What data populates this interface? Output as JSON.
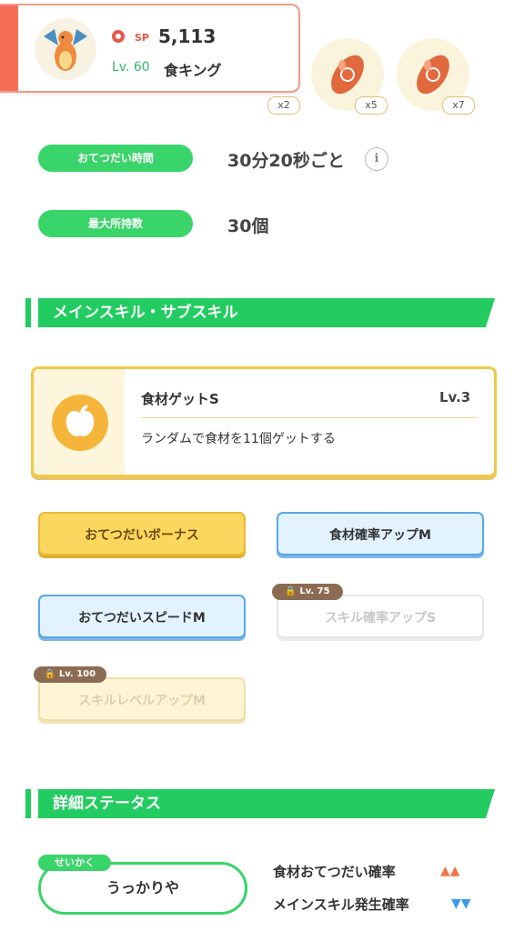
{
  "header": {
    "sp_label": "SP",
    "sp_value": "5,113",
    "level": "Lv. 60",
    "name": "食キング"
  },
  "ingredients": [
    {
      "count": "x2"
    },
    {
      "count": "x5"
    },
    {
      "count": "x7"
    }
  ],
  "stats": {
    "help_time_label": "おてつだい時間",
    "help_time_value": "30分20秒ごと",
    "info_icon": "i",
    "max_carry_label": "最大所持数",
    "max_carry_value": "30個"
  },
  "skills_section": {
    "title": "メインスキル・サブスキル",
    "main_skill": {
      "name": "食材ゲットS",
      "level": "Lv.3",
      "description": "ランダムで食材を11個ゲットする"
    },
    "sub_skills": [
      {
        "label": "おてつだいボーナス",
        "style": "gold"
      },
      {
        "label": "食材確率アップM",
        "style": "blue"
      },
      {
        "label": "おてつだいスピードM",
        "style": "blue"
      },
      {
        "label": "スキル確率アップS",
        "style": "locked",
        "lock": "Lv. 75"
      },
      {
        "label": "スキルレベルアップM",
        "style": "locked-gold",
        "lock": "Lv. 100"
      }
    ]
  },
  "details_section": {
    "title": "詳細ステータス",
    "nature_tag": "せいかく",
    "nature": "うっかりや",
    "up_effect": "食材おてつだい確率",
    "up_marks": "▲▲",
    "down_effect": "メインスキル発生確率",
    "down_marks": "▼▼"
  },
  "colors": {
    "accent_green": "#22cc60",
    "pill_green": "#39d46a",
    "header_red": "#f56f56",
    "up_orange": "#f2764a",
    "down_blue": "#3b9be8"
  },
  "icons": [
    "pokeball-sp-icon",
    "charizard-avatar",
    "sausage-ingredient-icon",
    "info-icon",
    "apple-icon",
    "lock-icon"
  ]
}
